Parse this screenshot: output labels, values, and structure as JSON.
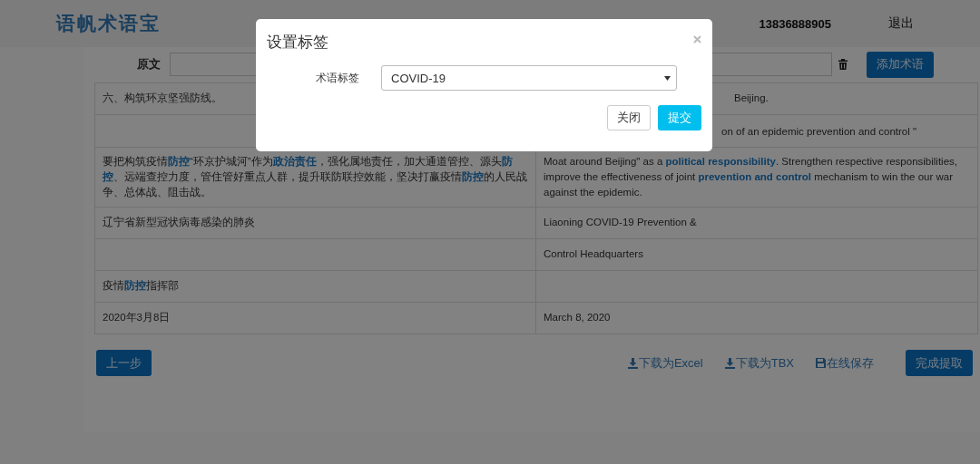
{
  "header": {
    "logo": "语帆术语宝",
    "user": "13836888905",
    "logout": "退出"
  },
  "search": {
    "label": "原文",
    "add_button": "添加术语"
  },
  "table": {
    "rows": [
      {
        "source": "六、构筑环京坚强防线。",
        "target": "Beijing."
      },
      {
        "target": "on of an epidemic prevention and control \""
      },
      {
        "source": "要把构筑疫情**防控**“环京护城河”作为**政治责任**，强化属地责任，加大通道管控、源头**防控**、远端查控力度，管住管好重点人群，提升联防联控效能，坚决打赢疫情**防控**的人民战争、总体战、阻击战。",
        "target": "Moat around Beijing\" as a **political responsibility**. Strengthen respective responsibilities, improve the effectiveness of joint **prevention and control** mechanism to win the our war against the epidemic."
      },
      {
        "source": "辽宁省新型冠状病毒感染的肺炎",
        "target": "Liaoning COVID-19 Prevention &"
      },
      {
        "target": "Control Headquarters"
      },
      {
        "source": "疫情**防控**指挥部"
      },
      {
        "source": "2020年3月8日",
        "target": "March 8, 2020"
      }
    ]
  },
  "footer": {
    "back_button": "上一步",
    "links": [
      {
        "kind": "download",
        "label": "下载为Excel"
      },
      {
        "kind": "download",
        "label": "下载为TBX"
      },
      {
        "kind": "save",
        "label": "在线保存"
      }
    ],
    "finish_button": "完成提取"
  },
  "dialog": {
    "title": "设置标签",
    "field_label": "术语标签",
    "select_value": "COVID-19",
    "buttons": [
      {
        "label": "关闭",
        "kind": "default"
      },
      {
        "label": "提交",
        "kind": "primary"
      }
    ]
  }
}
